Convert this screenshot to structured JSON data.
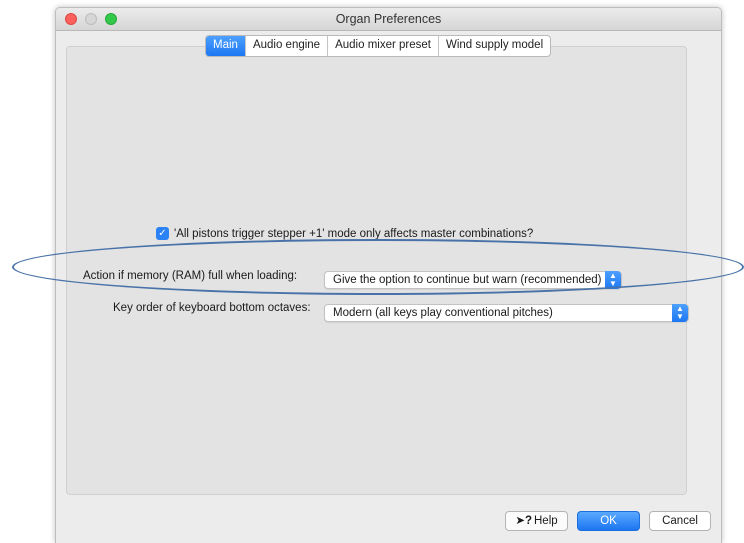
{
  "window": {
    "title": "Organ Preferences"
  },
  "tabs": [
    {
      "label": "Main",
      "active": true
    },
    {
      "label": "Audio engine",
      "active": false
    },
    {
      "label": "Audio mixer preset",
      "active": false
    },
    {
      "label": "Wind supply model",
      "active": false
    }
  ],
  "main": {
    "checkbox": {
      "checked": true,
      "label": "'All pistons trigger stepper +1' mode only affects master combinations?"
    },
    "memory_action": {
      "label": "Action if memory (RAM) full when loading:",
      "value": "Give the option to continue but warn (recommended)"
    },
    "key_order": {
      "label": "Key order of keyboard bottom octaves:",
      "value": "Modern (all keys play conventional pitches)"
    }
  },
  "buttons": {
    "help": "Help",
    "ok": "OK",
    "cancel": "Cancel"
  },
  "colors": {
    "accent": "#1c77f2",
    "annotation_ellipse": "#4973a8"
  }
}
